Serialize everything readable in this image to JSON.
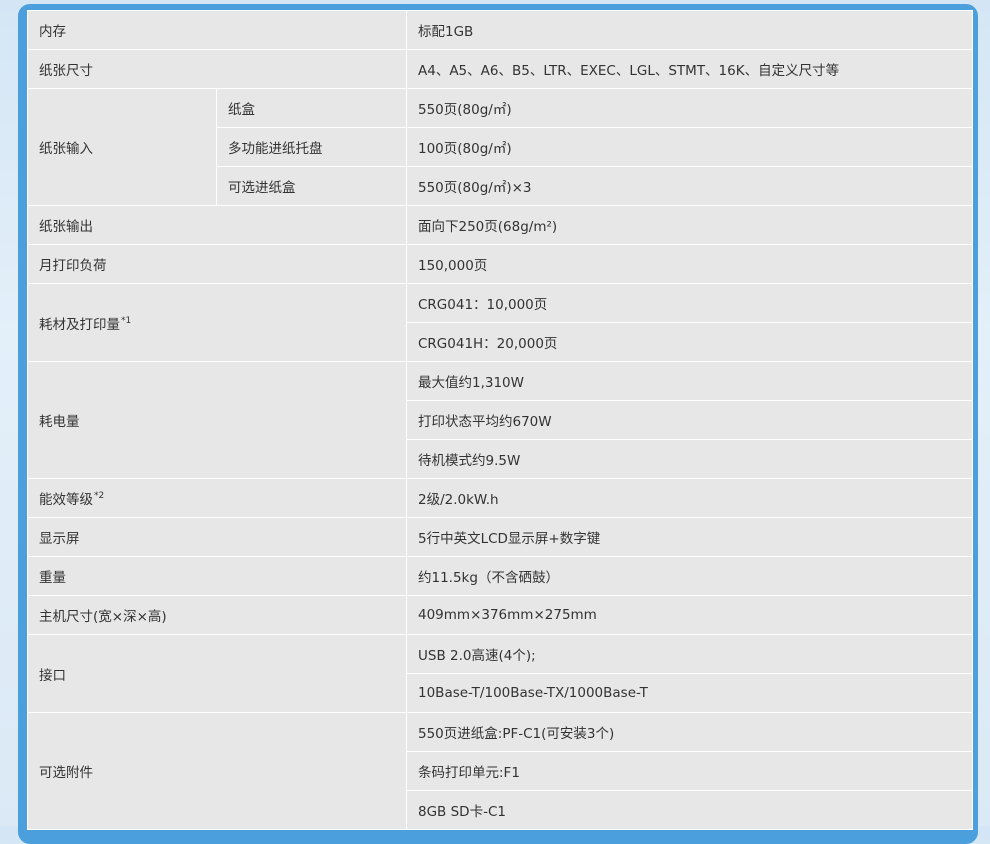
{
  "specs": [
    {
      "label": "内存",
      "values": [
        "标配1GB"
      ]
    },
    {
      "label": "纸张尺寸",
      "values": [
        "A4、A5、A6、B5、LTR、EXEC、LGL、STMT、16K、自定义尺寸等"
      ]
    },
    {
      "label": "纸张输入",
      "sub": [
        {
          "label": "纸盒",
          "value": "550页(80g/㎡)"
        },
        {
          "label": "多功能进纸托盘",
          "value": "100页(80g/㎡)"
        },
        {
          "label": "可选进纸盒",
          "value": "550页(80g/㎡)×3"
        }
      ]
    },
    {
      "label": "纸张输出",
      "values": [
        "面向下250页(68g/m²)"
      ]
    },
    {
      "label": "月打印负荷",
      "values": [
        "150,000页"
      ]
    },
    {
      "label": "耗材及打印量",
      "note": "*1",
      "values": [
        "CRG041：10,000页",
        "CRG041H：20,000页"
      ]
    },
    {
      "label": "耗电量",
      "values": [
        "最大值约1,310W",
        "打印状态平均约670W",
        "待机模式约9.5W"
      ]
    },
    {
      "label": "能效等级",
      "note": "*2",
      "values": [
        "2级/2.0kW.h"
      ]
    },
    {
      "label": "显示屏",
      "values": [
        "5行中英文LCD显示屏+数字键"
      ]
    },
    {
      "label": "重量",
      "values": [
        "约11.5kg（不含硒鼓）"
      ]
    },
    {
      "label": "主机尺寸(宽×深×高)",
      "values": [
        "409mm×376mm×275mm"
      ]
    },
    {
      "label": "接口",
      "values": [
        "USB 2.0高速(4个);",
        "10Base-T/100Base-TX/1000Base-T"
      ]
    },
    {
      "label": "可选附件",
      "values": [
        "550页进纸盒:PF-C1(可安装3个)",
        "条码打印单元:F1",
        "8GB SD卡-C1"
      ]
    }
  ]
}
